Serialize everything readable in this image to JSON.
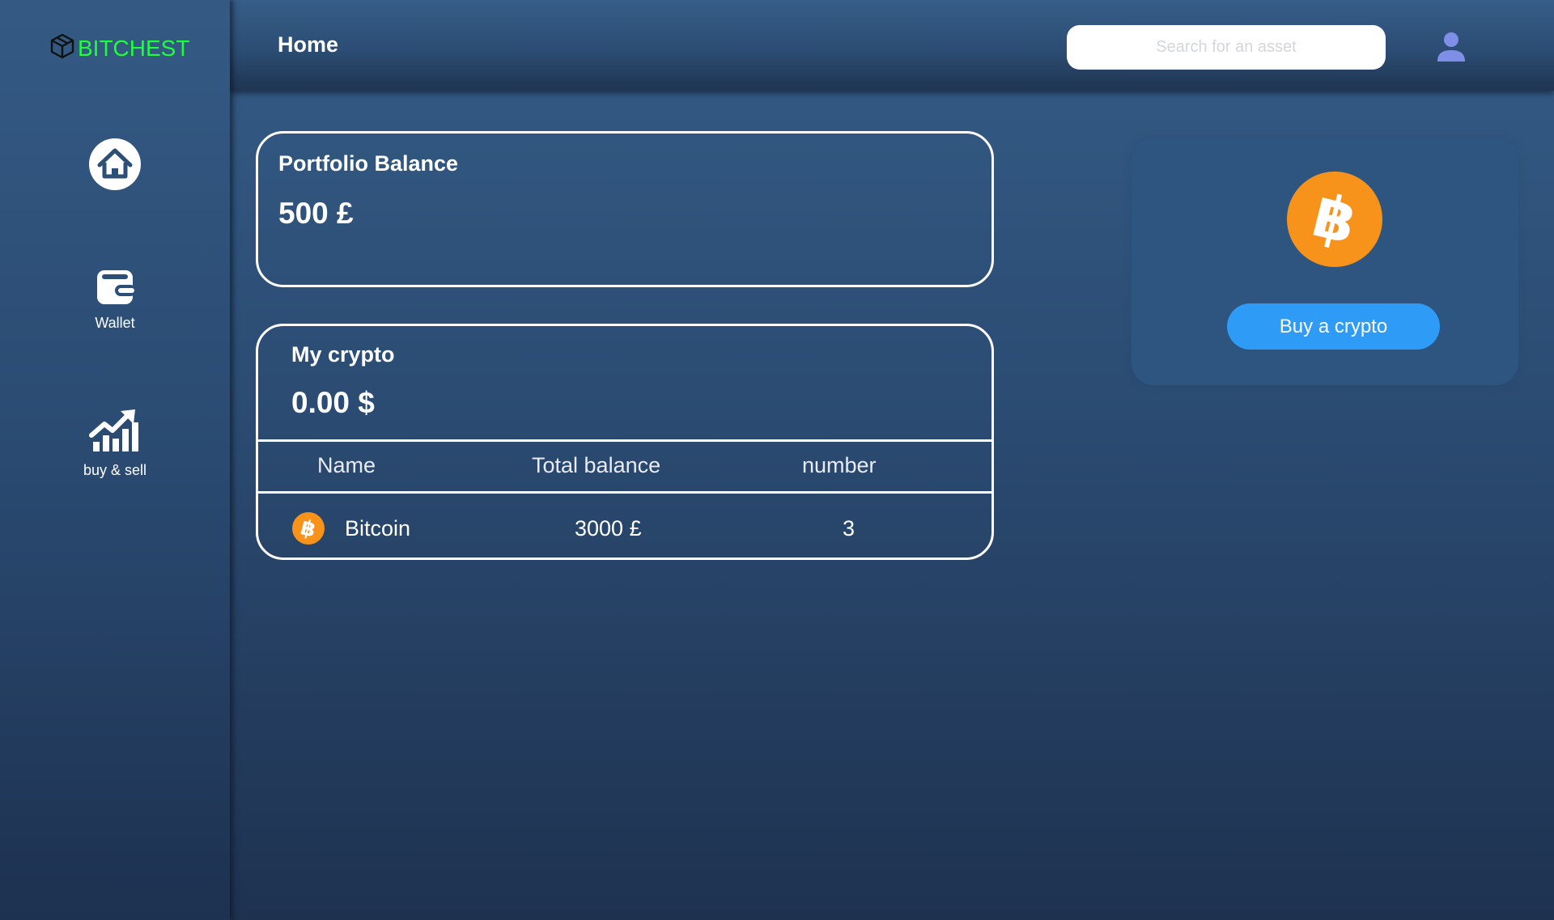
{
  "app": {
    "brand": "BITCHEST",
    "brand_color": "#1dff3b",
    "icon": "cube-logo-icon"
  },
  "sidebar": {
    "items": [
      {
        "label": "",
        "icon": "home-icon"
      },
      {
        "label": "Wallet",
        "icon": "wallet-icon"
      },
      {
        "label": "buy & sell",
        "icon": "growth-chart-icon"
      }
    ]
  },
  "header": {
    "title": "Home",
    "search_placeholder": "Search for an asset",
    "user_icon": "user-icon"
  },
  "portfolio": {
    "title": "Portfolio Balance",
    "value": "500 £"
  },
  "my_crypto": {
    "title": "My crypto",
    "value": "0.00 $",
    "columns": [
      "Name",
      "Total balance",
      "number"
    ],
    "rows": [
      {
        "icon": "bitcoin-icon",
        "name": "Bitcoin",
        "total_balance": "3000 £",
        "number": "3"
      }
    ]
  },
  "buy_panel": {
    "icon": "bitcoin-icon",
    "button_label": "Buy a crypto",
    "button_color": "#2e9bf6"
  },
  "colors": {
    "bitcoin_orange": "#f7931a",
    "background_top": "#345c86",
    "background_bottom": "#1e3250"
  }
}
